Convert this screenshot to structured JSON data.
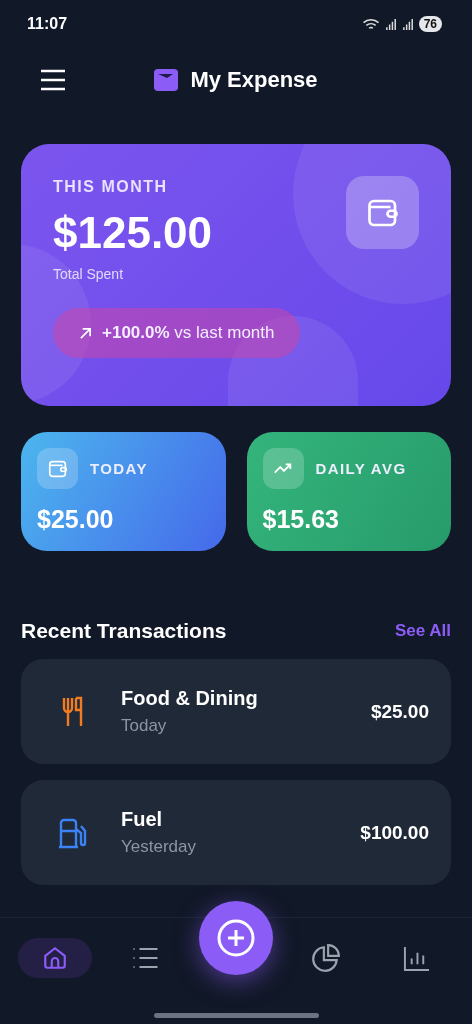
{
  "status_bar": {
    "time": "11:07",
    "battery": "76"
  },
  "header": {
    "title": "My Expense"
  },
  "summary": {
    "label": "THIS MONTH",
    "amount": "$125.00",
    "caption": "Total Spent",
    "change": "**+100.0%** vs last month"
  },
  "stats": [
    {
      "kind": "today",
      "label": "TODAY",
      "value": "$25.00"
    },
    {
      "kind": "average",
      "label": "DAILY AVG",
      "value": "$15.63"
    }
  ],
  "recent": {
    "title": "Recent Transactions",
    "link": "See All"
  },
  "transactions": [
    {
      "kind": "food",
      "name": "Food & Dining",
      "date": "Today",
      "amount": "$25.00"
    },
    {
      "kind": "fuel",
      "name": "Fuel",
      "date": "Yesterday",
      "amount": "$100.00"
    }
  ],
  "nav": {
    "items": [
      {
        "kind": "home",
        "selected": true
      },
      {
        "kind": "list",
        "selected": false
      },
      {
        "kind": "add",
        "selected": false
      },
      {
        "kind": "chart",
        "selected": false
      },
      {
        "kind": "stats",
        "selected": false
      }
    ]
  }
}
